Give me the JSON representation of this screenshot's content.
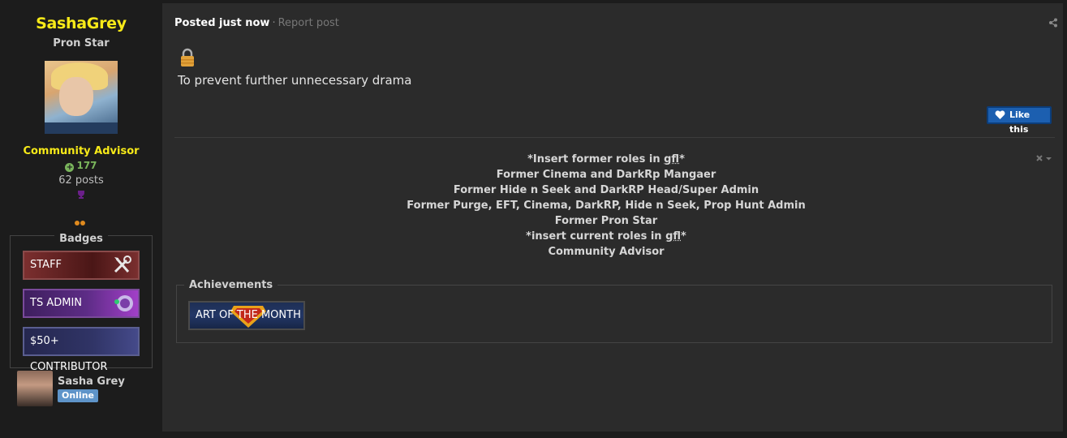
{
  "author": {
    "username": "SashaGrey",
    "title": "Pron Star",
    "group": "Community Advisor",
    "reputation": "177",
    "posts": "62 posts",
    "badges_label": "Badges",
    "badges": [
      {
        "label": "STAFF",
        "icon": "tools-icon"
      },
      {
        "label": "TS ADMIN",
        "icon": "teamspeak-icon"
      },
      {
        "label": "$50+ CONTRIBUTOR",
        "icon": ""
      }
    ],
    "linked_name": "Sasha Grey",
    "linked_status": "Online"
  },
  "post": {
    "posted": "Posted just now",
    "separator": "·",
    "report": "Report post",
    "text": "To prevent further unnecessary drama",
    "like_label": "Like this"
  },
  "signature": {
    "line1_a": "*Insert former roles in ",
    "line1_b": "gfl",
    "line1_c": "*",
    "line2": "Former Cinema and DarkRp Mangaer",
    "line3": "Former Hide n Seek and DarkRP Head/Super Admin",
    "line4": "Former Purge, EFT, Cinema, DarkRP, Hide n Seek, Prop Hunt Admin",
    "line5": "Former Pron Star",
    "line6_a": "*insert current roles in ",
    "line6_b": "gfl",
    "line6_c": "*",
    "line7": "Community Advisor"
  },
  "achievements": {
    "label": "Achievements",
    "items": [
      {
        "label": "ART OF THE MONTH"
      }
    ]
  },
  "colors": {
    "username": "#f7ea18",
    "reputation": "#7ab55c",
    "online": "#5e94c9",
    "like": "#1c5fb0"
  }
}
